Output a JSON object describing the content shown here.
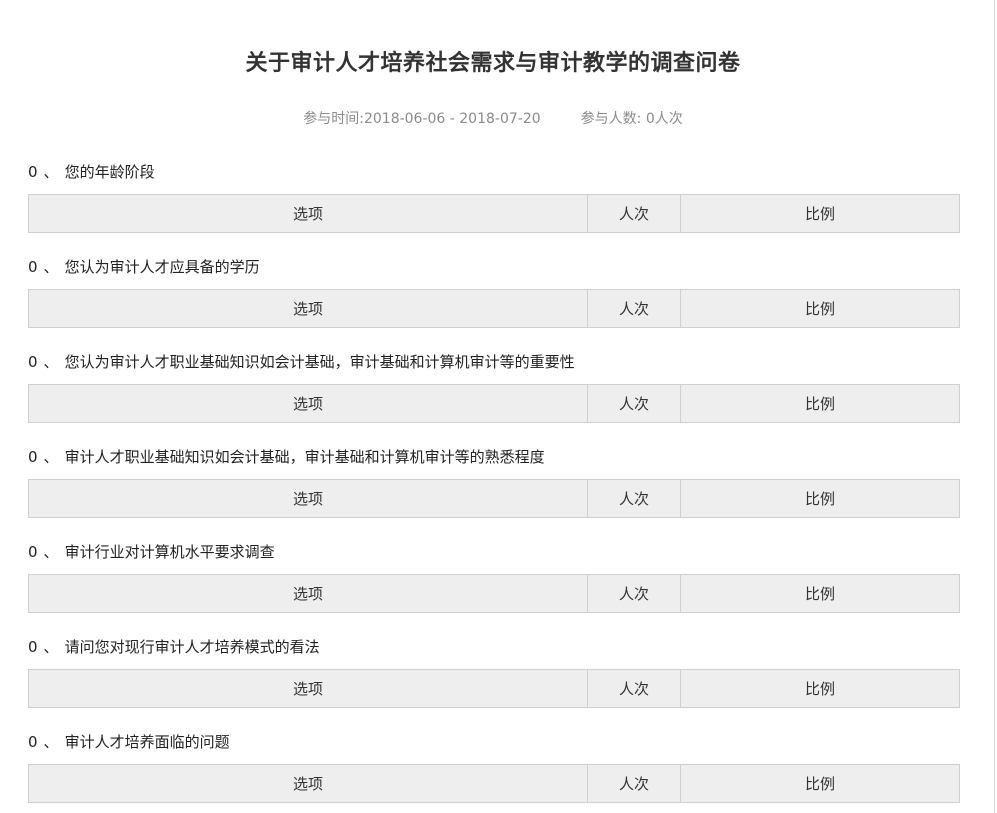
{
  "survey": {
    "title": "关于审计人才培养社会需求与审计教学的调查问卷",
    "time_label": "参与时间:2018-06-06 - 2018-07-20",
    "participants_label": "参与人数: 0人次"
  },
  "table_headers": {
    "option": "选项",
    "count": "人次",
    "ratio": "比例"
  },
  "questions": [
    {
      "number": "0",
      "separator": "、",
      "text": "您的年龄阶段"
    },
    {
      "number": "0",
      "separator": "、",
      "text": "您认为审计人才应具备的学历"
    },
    {
      "number": "0",
      "separator": "、",
      "text": "您认为审计人才职业基础知识如会计基础，审计基础和计算机审计等的重要性"
    },
    {
      "number": "0",
      "separator": "、",
      "text": "审计人才职业基础知识如会计基础，审计基础和计算机审计等的熟悉程度"
    },
    {
      "number": "0",
      "separator": "、",
      "text": "审计行业对计算机水平要求调查"
    },
    {
      "number": "0",
      "separator": "、",
      "text": "请问您对现行审计人才培养模式的看法"
    },
    {
      "number": "0",
      "separator": "、",
      "text": "审计人才培养面临的问题"
    }
  ]
}
